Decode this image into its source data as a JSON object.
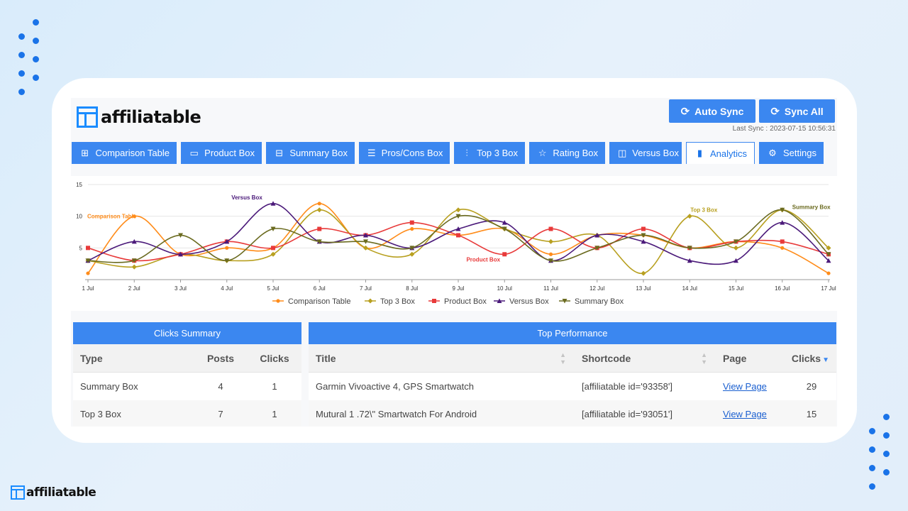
{
  "brand": {
    "name": "affiliatable"
  },
  "header": {
    "auto_sync_label": "Auto Sync",
    "sync_all_label": "Sync All",
    "last_sync_label": "Last Sync :",
    "last_sync_value": "2023-07-15 10:56:31"
  },
  "tabs": [
    {
      "label": "Comparison Table",
      "icon": "table-icon",
      "glyph": "⊞",
      "active": false
    },
    {
      "label": "Product Box",
      "icon": "card-icon",
      "glyph": "▭",
      "active": false
    },
    {
      "label": "Summary Box",
      "icon": "minus-box-icon",
      "glyph": "⊟",
      "active": false
    },
    {
      "label": "Pros/Cons Box",
      "icon": "list-icon",
      "glyph": "☰",
      "active": false
    },
    {
      "label": "Top 3 Box",
      "icon": "sliders-icon",
      "glyph": "⫶",
      "active": false
    },
    {
      "label": "Rating Box",
      "icon": "star-icon",
      "glyph": "☆",
      "active": false
    },
    {
      "label": "Versus Box",
      "icon": "columns-icon",
      "glyph": "◫",
      "active": false
    },
    {
      "label": "Analytics",
      "icon": "bar-chart-icon",
      "glyph": "▮",
      "active": true
    },
    {
      "label": "Settings",
      "icon": "gear-icon",
      "glyph": "⚙",
      "active": false
    }
  ],
  "chart_data": {
    "type": "line",
    "categories": [
      "1 Jul",
      "2 Jul",
      "3 Jul",
      "4 Jul",
      "5 Jul",
      "6 Jul",
      "7 Jul",
      "8 Jul",
      "9 Jul",
      "10 Jul",
      "11 Jul",
      "12 Jul",
      "13 Jul",
      "14 Jul",
      "15 Jul",
      "16 Jul",
      "17 Jul"
    ],
    "ylim": [
      0,
      15
    ],
    "yticks": [
      5,
      10,
      15
    ],
    "grid": true,
    "legend_position": "bottom",
    "series": [
      {
        "name": "Comparison Table",
        "color": "#ff8c1a",
        "marker": "circle",
        "values": [
          1,
          10,
          4,
          5,
          5,
          12,
          5,
          8,
          7,
          8,
          4,
          7,
          7,
          5,
          6,
          5,
          1
        ]
      },
      {
        "name": "Top 3 Box",
        "color": "#b8a020",
        "marker": "diamond",
        "values": [
          3,
          2,
          4,
          3,
          4,
          11,
          5,
          4,
          11,
          8,
          6,
          7,
          1,
          10,
          5,
          11,
          5
        ]
      },
      {
        "name": "Product Box",
        "color": "#e83a3a",
        "marker": "square",
        "values": [
          5,
          3,
          4,
          6,
          5,
          8,
          7,
          9,
          7,
          4,
          8,
          5,
          8,
          5,
          6,
          6,
          4
        ]
      },
      {
        "name": "Versus Box",
        "color": "#4b1a7a",
        "marker": "triangle-up",
        "values": [
          3,
          6,
          4,
          6,
          12,
          6,
          7,
          5,
          8,
          9,
          3,
          7,
          6,
          3,
          3,
          9,
          3
        ]
      },
      {
        "name": "Summary Box",
        "color": "#6b6b20",
        "marker": "triangle-down",
        "values": [
          3,
          3,
          7,
          3,
          8,
          6,
          6,
          5,
          10,
          8,
          3,
          5,
          7,
          5,
          6,
          11,
          4
        ]
      }
    ],
    "annotations": [
      {
        "text": "Comparison Table",
        "series": "Comparison Table",
        "x": "2 Jul"
      },
      {
        "text": "Versus Box",
        "series": "Versus Box",
        "x": "5 Jul"
      },
      {
        "text": "Product Box",
        "series": "Product Box",
        "x": "10 Jul"
      },
      {
        "text": "Top 3 Box",
        "series": "Top 3 Box",
        "x": "14 Jul"
      },
      {
        "text": "Summary Box",
        "series": "Summary Box",
        "x": "16 Jul"
      }
    ]
  },
  "clicks_summary": {
    "title": "Clicks Summary",
    "columns": [
      "Type",
      "Posts",
      "Clicks"
    ],
    "rows": [
      [
        "Summary Box",
        "4",
        "1"
      ],
      [
        "Top 3 Box",
        "7",
        "1"
      ]
    ]
  },
  "top_performance": {
    "title": "Top Performance",
    "columns": [
      "Title",
      "Shortcode",
      "Page",
      "Clicks"
    ],
    "rows": [
      [
        "Garmin Vivoactive 4, GPS Smartwatch",
        "[affiliatable id='93358']",
        "View Page",
        "29"
      ],
      [
        "Mutural 1 .72\\\" Smartwatch For Android",
        "[affiliatable id='93051']",
        "View Page",
        "15"
      ]
    ]
  }
}
